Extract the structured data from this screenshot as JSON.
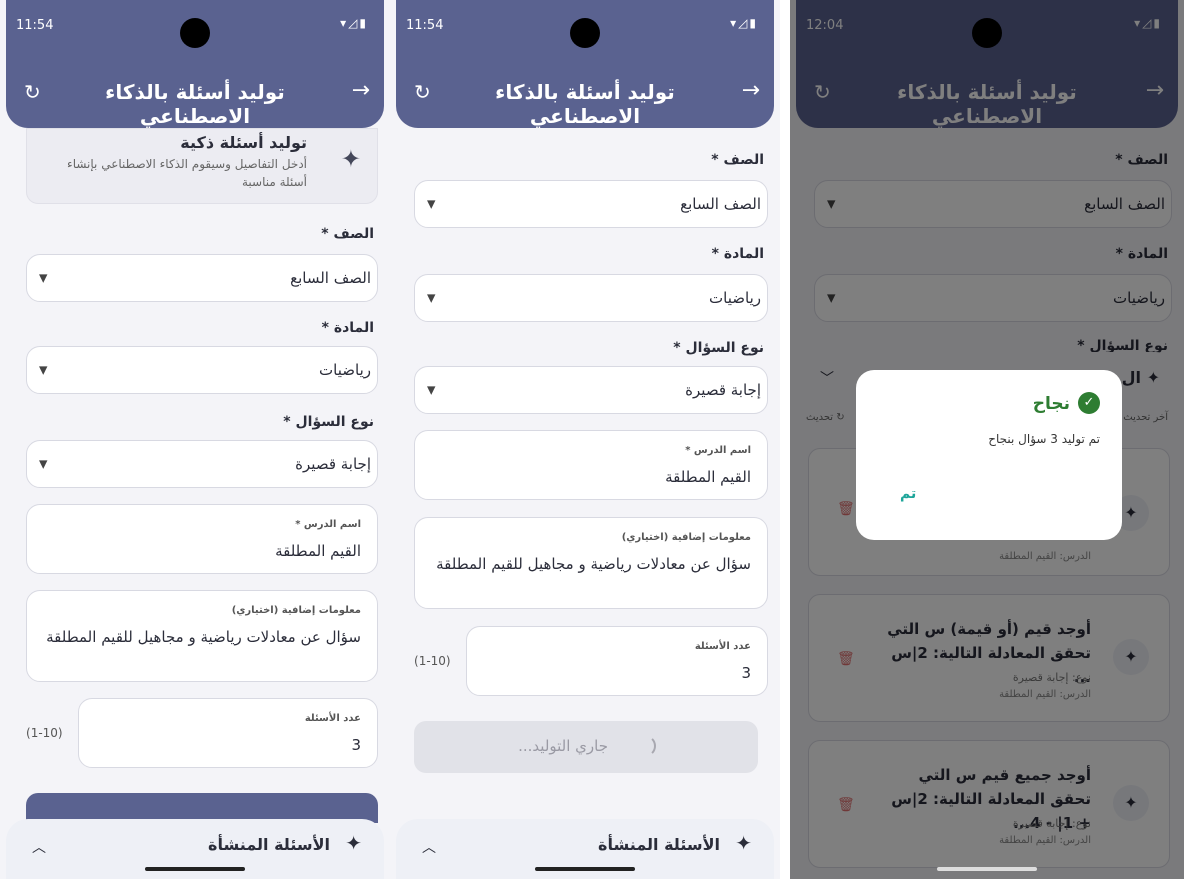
{
  "screen1": {
    "status_time": "11:54",
    "app_title": "توليد أسئلة بالذكاء الاصطناعي",
    "info": {
      "title": "توليد أسئلة ذكية",
      "desc": "أدخل التفاصيل وسيقوم الذكاء الاصطناعي بإنشاء أسئلة مناسبة"
    },
    "grade_label": "الصف *",
    "grade_value": "الصف السابع",
    "subject_label": "المادة *",
    "subject_value": "رياضيات",
    "qtype_label": "نوع السؤال *",
    "qtype_value": "إجابة قصيرة",
    "lesson_label": "اسم الدرس *",
    "lesson_value": "القيم المطلقة",
    "extra_label": "معلومات إضافية (اختياري)",
    "extra_value": "سؤال عن معادلات رياضية و مجاهيل للقيم المطلقة",
    "count_label": "عدد الأسئلة",
    "count_value": "3",
    "count_range": "(1-10)",
    "bottom_title": "الأسئلة المنشأة"
  },
  "screen2": {
    "status_time": "11:54",
    "app_title": "توليد أسئلة بالذكاء الاصطناعي",
    "grade_label": "الصف *",
    "grade_value": "الصف السابع",
    "subject_label": "المادة *",
    "subject_value": "رياضيات",
    "qtype_label": "نوع السؤال *",
    "qtype_value": "إجابة قصيرة",
    "lesson_label": "اسم الدرس *",
    "lesson_value": "القيم المطلقة",
    "extra_label": "معلومات إضافية (اختياري)",
    "extra_value": "سؤال عن معادلات رياضية و مجاهيل للقيم المطلقة",
    "count_label": "عدد الأسئلة",
    "count_value": "3",
    "count_range": "(1-10)",
    "generating_label": "جاري التوليد...",
    "bottom_title": "الأسئلة المنشأة"
  },
  "screen3": {
    "status_time": "12:04",
    "app_title": "توليد أسئلة بالذكاء الاصطناعي",
    "grade_label": "الصف *",
    "grade_value": "الصف السابع",
    "subject_label": "المادة *",
    "subject_value": "رياضيات",
    "qtype_label": "نوع السؤال *",
    "sheet_title": "ال",
    "last_update": "آخر تحديث",
    "refresh_label": "تحديث",
    "card1_lesson": "الدرس: القيم المطلقة",
    "card2_title": "أوجد قيم (أو قيمة) س التي تحقق المعادلة التالية: 2|س ...",
    "card2_type": "نوع: إجابة قصيرة",
    "card2_lesson": "الدرس: القيم المطلقة",
    "card3_title": "أوجد جميع قيم س التي تحقق المعادلة التالية: 2|س + 1| - 4...",
    "card3_type": "نوع: إجابة قصيرة",
    "card3_lesson": "الدرس: القيم المطلقة",
    "dialog_title": "نجاح",
    "dialog_message": "تم توليد 3 سؤال بنجاح",
    "dialog_ok": "تم"
  },
  "icons": {
    "back": "arrow-right-icon",
    "refresh": "refresh-icon",
    "sparkle": "sparkle-icon",
    "dropdown": "caret-down-icon",
    "trash": "trash-icon",
    "check": "check-circle-icon",
    "chevron_up": "chevron-up-icon",
    "chevron_down": "chevron-down-icon"
  },
  "colors": {
    "appbar": "#5a6290",
    "success": "#2e7d32",
    "ok_button": "#1ea59a",
    "delete": "#e07070"
  }
}
